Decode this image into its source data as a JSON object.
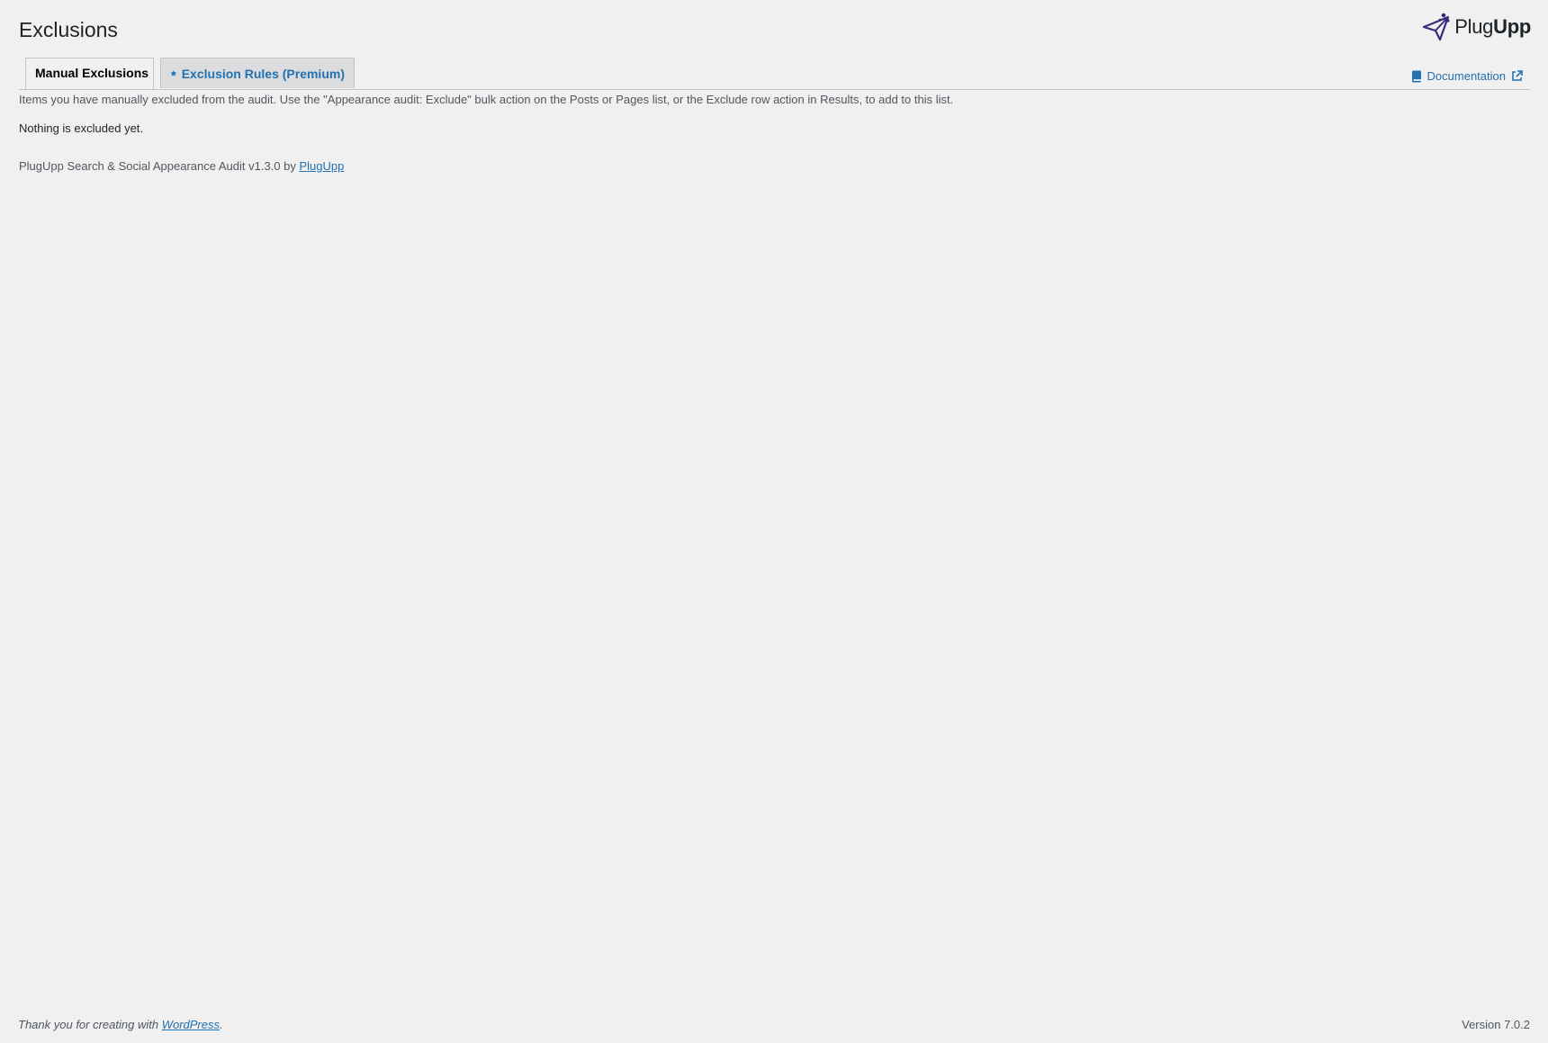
{
  "page": {
    "title": "Exclusions"
  },
  "brand": {
    "name_light": "Plug",
    "name_bold": "Upp"
  },
  "tabs": [
    {
      "label": "Manual Exclusions",
      "active": true
    },
    {
      "label": "Exclusion Rules (Premium)",
      "active": false,
      "icon": "star-icon"
    }
  ],
  "documentation": {
    "label": "Documentation",
    "icon": "book-icon",
    "external_icon": "external-link-icon"
  },
  "content": {
    "description": "Items you have manually excluded from the audit. Use the \"Appearance audit: Exclude\" bulk action on the Posts or Pages list, or the Exclude row action in Results, to add to this list.",
    "empty_message": "Nothing is excluded yet."
  },
  "plugin_credit": {
    "text": "PlugUpp Search & Social Appearance Audit v1.3.0 by ",
    "link_label": "PlugUpp"
  },
  "footer": {
    "thanks_prefix": "Thank you for creating with ",
    "wordpress_link": "WordPress",
    "thanks_suffix": ".",
    "version": "Version 7.0.2"
  },
  "colors": {
    "background": "#f0f0f1",
    "accent": "#2271b1",
    "brand": "#3b2a7a"
  }
}
